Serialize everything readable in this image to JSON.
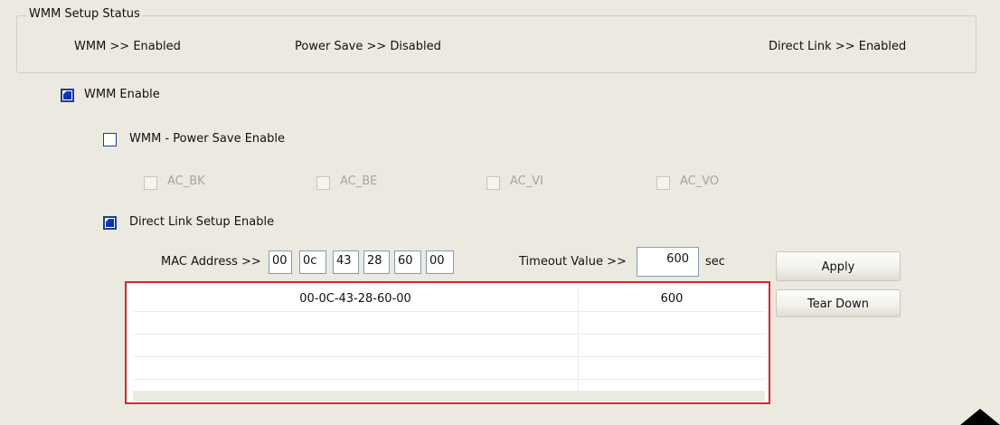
{
  "status": {
    "legend": "WMM Setup Status",
    "wmm": "WMM >> Enabled",
    "power_save": "Power Save >> Disabled",
    "direct_link": "Direct Link >> Enabled"
  },
  "options": {
    "wmm_enable": "WMM Enable",
    "power_save_enable": "WMM - Power Save Enable",
    "ac_bk": "AC_BK",
    "ac_be": "AC_BE",
    "ac_vi": "AC_VI",
    "ac_vo": "AC_VO",
    "direct_link_enable": "Direct Link Setup Enable"
  },
  "mac": {
    "label": "MAC Address >>",
    "octets": [
      "00",
      "0c",
      "43",
      "28",
      "60",
      "00"
    ]
  },
  "timeout": {
    "label": "Timeout Value >>",
    "value": "600",
    "unit": "sec"
  },
  "buttons": {
    "apply": "Apply",
    "tear_down": "Tear Down"
  },
  "links": [
    {
      "mac": "00-0C-43-28-60-00",
      "timeout": "600"
    },
    {
      "mac": "",
      "timeout": ""
    },
    {
      "mac": "",
      "timeout": ""
    },
    {
      "mac": "",
      "timeout": ""
    },
    {
      "mac": "",
      "timeout": ""
    }
  ]
}
